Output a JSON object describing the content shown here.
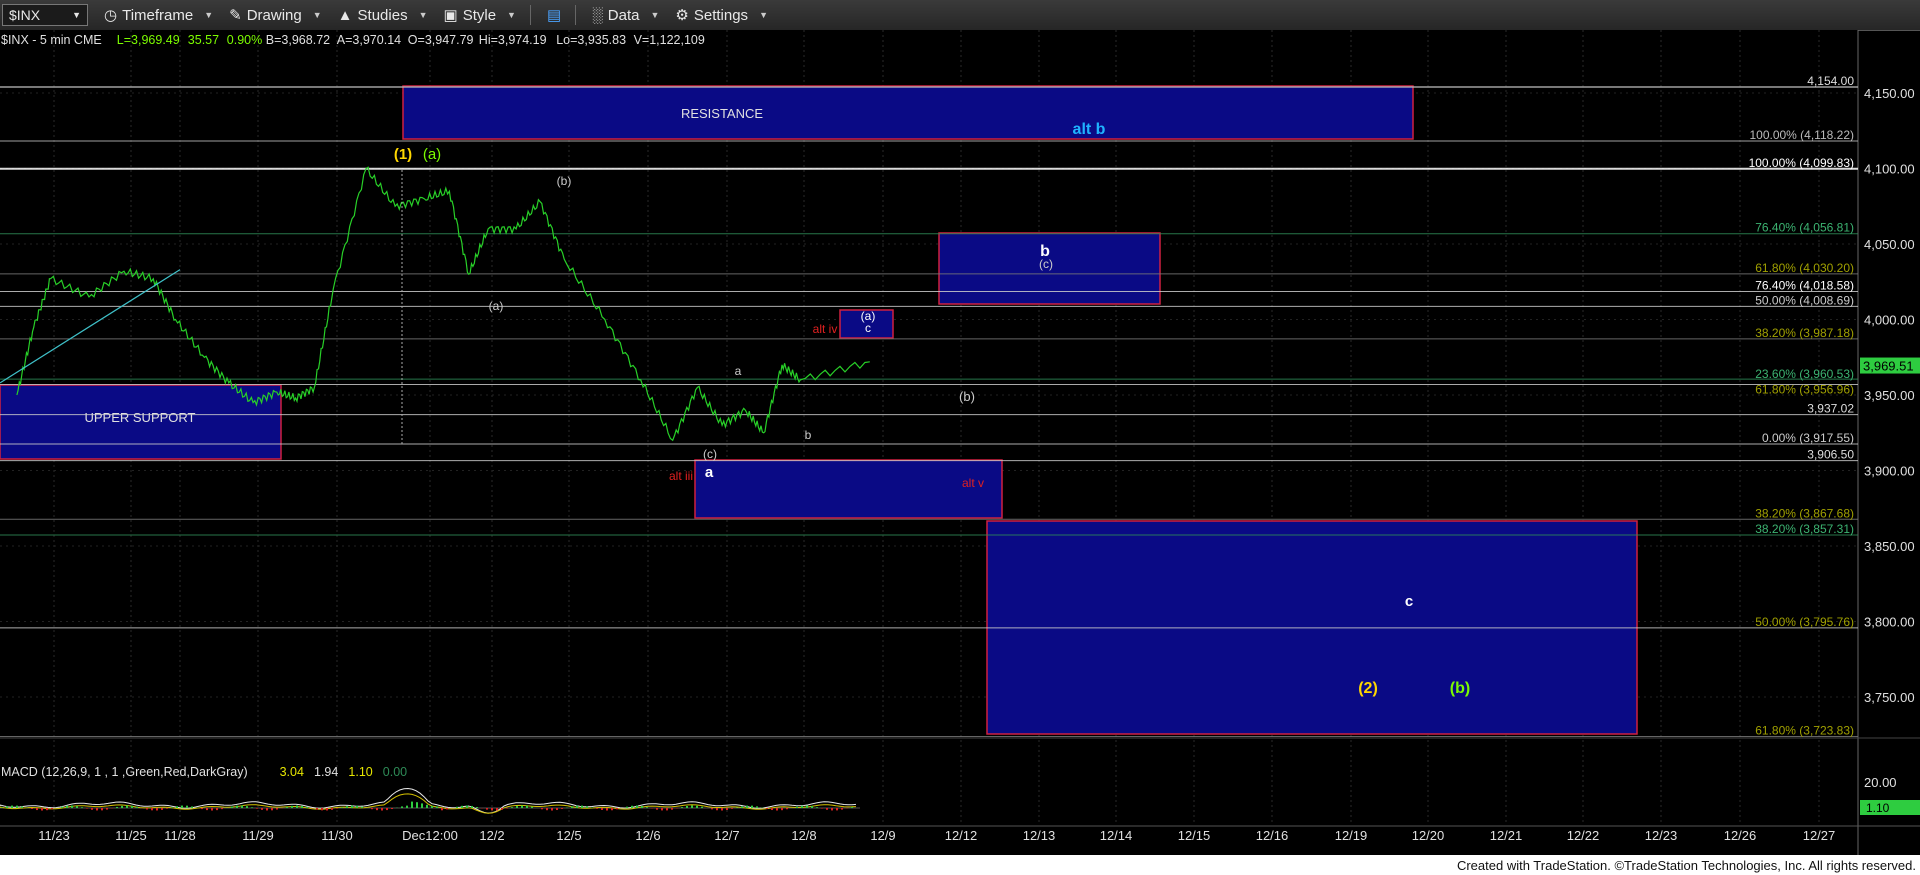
{
  "toolbar": {
    "symbol": "$INX",
    "items": [
      "Timeframe",
      "Drawing",
      "Studies",
      "Style",
      "Data",
      "Settings"
    ]
  },
  "header_line": [
    {
      "text": "$INX - 5 min  CME",
      "color": "#e0e0e0"
    },
    {
      "text": "L=3,969.49",
      "color": "#7cfc00"
    },
    {
      "text": "35.57",
      "color": "#7cfc00"
    },
    {
      "text": "0.90%",
      "color": "#7cfc00"
    },
    {
      "text": "B=3,968.72",
      "color": "#e0e0e0"
    },
    {
      "text": "A=3,970.14",
      "color": "#e0e0e0"
    },
    {
      "text": "O=3,947.79",
      "color": "#e0e0e0"
    },
    {
      "text": "Hi=3,974.19",
      "color": "#e0e0e0"
    },
    {
      "text": "Lo=3,935.83",
      "color": "#e0e0e0"
    },
    {
      "text": "V=1,122,109",
      "color": "#e0e0e0"
    }
  ],
  "macd_header": [
    {
      "text": "MACD (12,26,9, 1 , 1 ,Green,Red,DarkGray)",
      "color": "#e0e0e0"
    },
    {
      "text": "3.04",
      "color": "#e6e600"
    },
    {
      "text": "1.94",
      "color": "#e0e0e0"
    },
    {
      "text": "1.10",
      "color": "#e6e600"
    },
    {
      "text": "0.00",
      "color": "#2e8b57"
    }
  ],
  "footer": "Created with TradeStation. ©TradeStation Technologies, Inc. All rights reserved.",
  "chart_data": {
    "type": "line",
    "title": "$INX - 5 min",
    "x_ticks": [
      "11/23",
      "11/25",
      "11/28",
      "11/29",
      "11/30",
      "Dec12:00",
      "12/2",
      "12/5",
      "12/6",
      "12/7",
      "12/8",
      "12/9",
      "12/12",
      "12/13",
      "12/14",
      "12/15",
      "12/16",
      "12/19",
      "12/20",
      "12/21",
      "12/22",
      "12/23",
      "12/26",
      "12/27"
    ],
    "y_ticks": [
      3750,
      3800,
      3850,
      3900,
      3950,
      4000,
      4050,
      4100,
      4150
    ],
    "y_tick_labels": [
      "3,750.00",
      "3,800.00",
      "3,850.00",
      "3,900.00",
      "3,950.00",
      "4,000.00",
      "4,050.00",
      "4,100.00",
      "4,150.00"
    ],
    "ylim": [
      3725,
      4175
    ],
    "last_price": "3,969.51",
    "macd_ticks": [
      "20.00"
    ],
    "macd_last": "1.10",
    "series": [
      {
        "name": "$INX",
        "color": "#28d028",
        "values": [
          {
            "x": "11/23",
            "y": 3950
          },
          {
            "x": "11/23",
            "y": 3995
          },
          {
            "x": "11/23",
            "y": 4027
          },
          {
            "x": "11/25",
            "y": 4015
          },
          {
            "x": "11/25",
            "y": 4032
          },
          {
            "x": "11/28",
            "y": 4027
          },
          {
            "x": "11/28",
            "y": 4000
          },
          {
            "x": "11/29",
            "y": 3975
          },
          {
            "x": "11/29",
            "y": 3958
          },
          {
            "x": "11/29",
            "y": 3945
          },
          {
            "x": "11/30",
            "y": 3952
          },
          {
            "x": "11/30",
            "y": 3948
          },
          {
            "x": "11/30",
            "y": 3955
          },
          {
            "x": "11/30",
            "y": 4020
          },
          {
            "x": "Dec12:00",
            "y": 4100
          },
          {
            "x": "Dec12:00",
            "y": 4075
          },
          {
            "x": "Dec12:00",
            "y": 4080
          },
          {
            "x": "12/2",
            "y": 4085
          },
          {
            "x": "12/2",
            "y": 4030
          },
          {
            "x": "12/2",
            "y": 4060
          },
          {
            "x": "12/5",
            "y": 4060
          },
          {
            "x": "12/5",
            "y": 4078
          },
          {
            "x": "12/5",
            "y": 4040
          },
          {
            "x": "12/6",
            "y": 4000
          },
          {
            "x": "12/6",
            "y": 3960
          },
          {
            "x": "12/7",
            "y": 3920
          },
          {
            "x": "12/7",
            "y": 3955
          },
          {
            "x": "12/7",
            "y": 3930
          },
          {
            "x": "12/8",
            "y": 3940
          },
          {
            "x": "12/8",
            "y": 3925
          },
          {
            "x": "12/8",
            "y": 3970
          },
          {
            "x": "12/8",
            "y": 3960
          },
          {
            "x": "12/9",
            "y": 3972
          }
        ]
      }
    ],
    "levels": [
      {
        "label": "4,154.00",
        "y": 4154
      },
      {
        "label": "100.00% (4,118.22)",
        "y": 4118.22
      },
      {
        "label": "100.00% (4,099.83)",
        "y": 4099.83
      },
      {
        "label": "76.40% (4,056.81)",
        "y": 4056.81
      },
      {
        "label": "61.80% (4,030.20)",
        "y": 4030.2
      },
      {
        "label": "76.40% (4,018.58)",
        "y": 4018.58
      },
      {
        "label": "50.00% (4,008.69)",
        "y": 4008.69
      },
      {
        "label": "38.20% (3,987.18)",
        "y": 3987.18
      },
      {
        "label": "23.60% (3,960.53)",
        "y": 3960.53
      },
      {
        "label": "61.80% (3,956.96)",
        "y": 3956.96
      },
      {
        "label": "3,937.02",
        "y": 3937.02
      },
      {
        "label": "0.00% (3,917.55)",
        "y": 3917.55
      },
      {
        "label": "3,906.50",
        "y": 3906.5
      },
      {
        "label": "38.20% (3,867.68)",
        "y": 3867.68
      },
      {
        "label": "38.20% (3,857.31)",
        "y": 3857.31
      },
      {
        "label": "50.00% (3,795.76)",
        "y": 3795.76
      },
      {
        "label": "61.80% (3,723.83)",
        "y": 3723.83
      }
    ],
    "zones": [
      {
        "label": "RESISTANCE",
        "x_from": "Dec12:00",
        "x_to": "12/20",
        "y_from": 4118,
        "y_to": 4154
      },
      {
        "label": "UPPER SUPPORT",
        "x_from": "11/23",
        "x_to": "11/29",
        "y_from": 3907,
        "y_to": 3956
      },
      {
        "label": "b",
        "x_from": "12/12",
        "x_to": "12/14",
        "y_from": 4009,
        "y_to": 4057
      },
      {
        "label": "(a) c",
        "x_from": "12/9",
        "x_to": "12/9",
        "y_from": 3987,
        "y_to": 4006
      },
      {
        "label": "a",
        "x_from": "12/7",
        "x_to": "12/12",
        "y_from": 3868,
        "y_to": 3907
      },
      {
        "label": "c",
        "x_from": "12/12",
        "x_to": "12/22",
        "y_from": 3724,
        "y_to": 3868
      }
    ],
    "annotations": [
      "(1)",
      "(a)",
      "(b)",
      "(a)",
      "(c)",
      "a",
      "b",
      "alt iv",
      "alt iii",
      "alt v",
      "alt b",
      "(b)",
      "b",
      "(c)",
      "(a)",
      "c",
      "a",
      "c",
      "(2)",
      "(b)"
    ]
  }
}
